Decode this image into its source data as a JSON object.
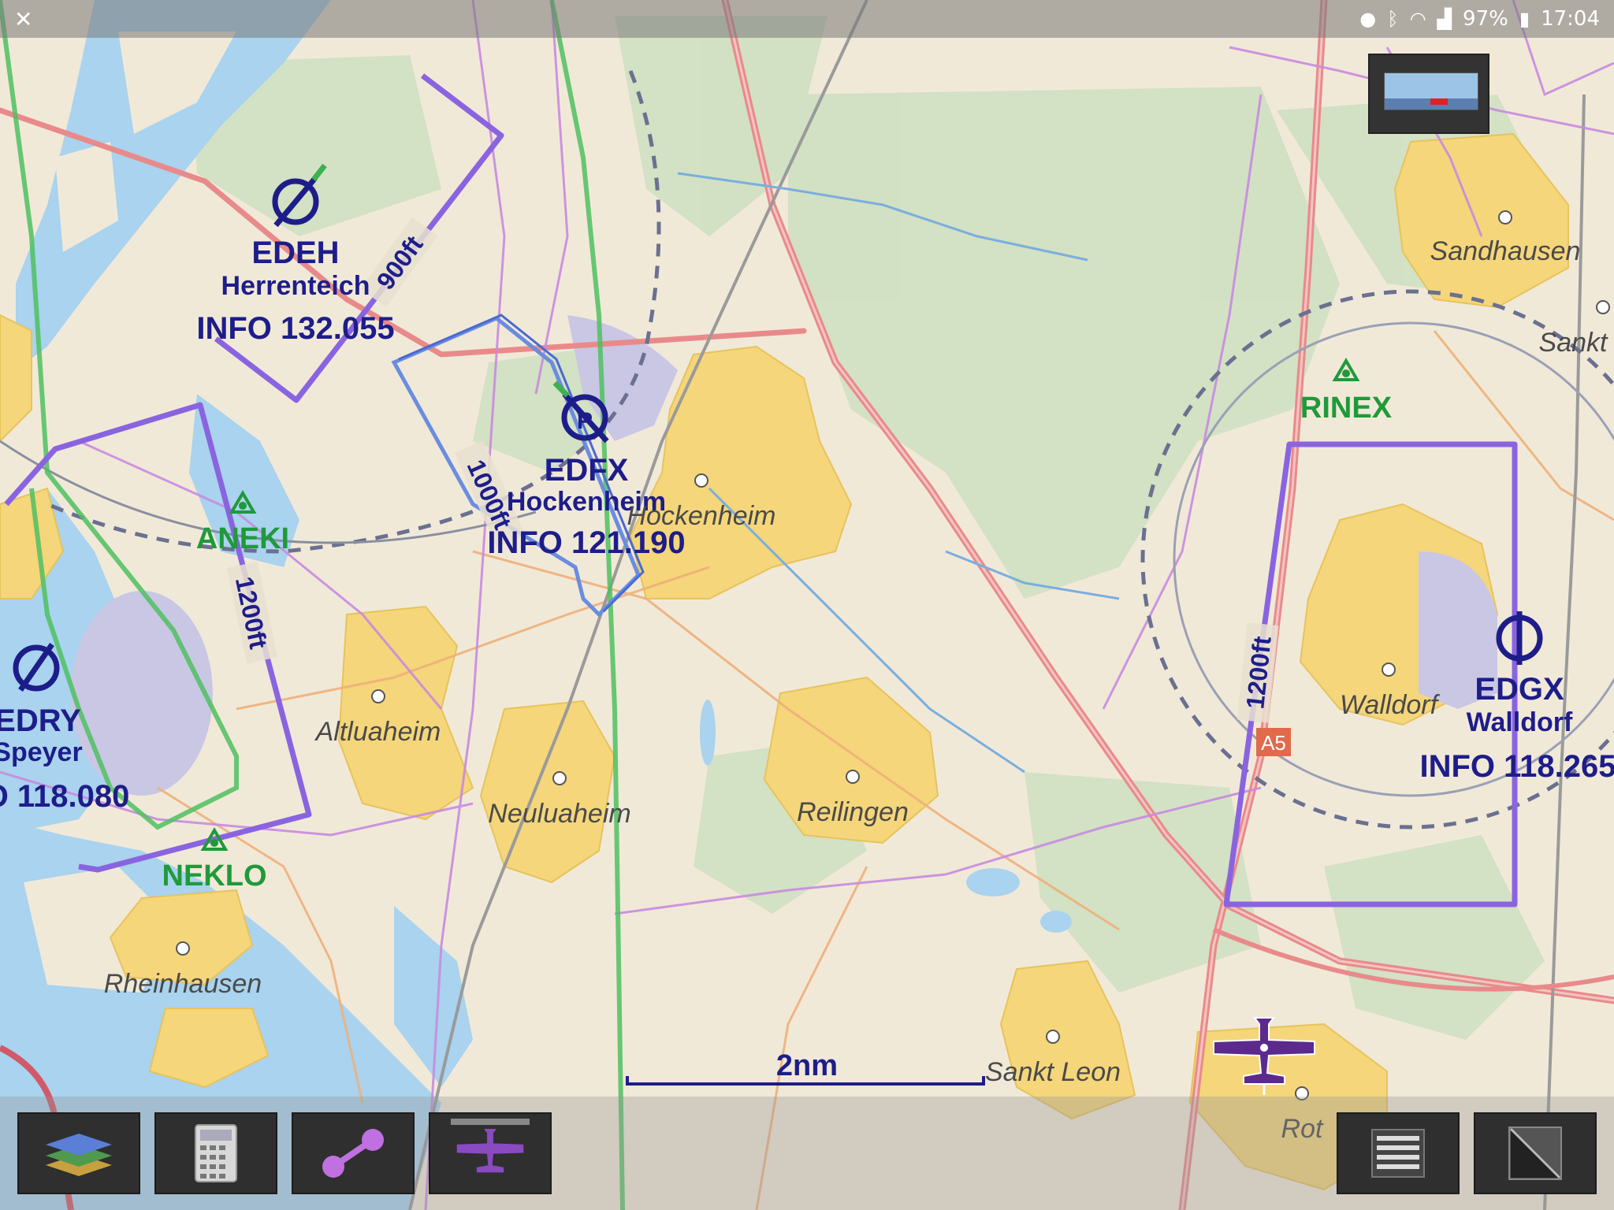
{
  "status_bar": {
    "app_icon": "x-icon",
    "battery_percent": "97%",
    "time": "17:04",
    "icons": [
      "location-icon",
      "bluetooth-icon",
      "wifi-icon",
      "signal-icon",
      "battery-icon"
    ]
  },
  "airports": [
    {
      "icao": "EDEH",
      "name": "Herrenteich",
      "freq": "INFO 132.055"
    },
    {
      "icao": "EDFX",
      "name": "Hockenheim",
      "freq": "INFO 121.190"
    },
    {
      "icao": "EDGX",
      "name": "Walldorf",
      "freq": "INFO 118.265"
    },
    {
      "icao": "EDRY",
      "name": "Speyer",
      "freq": "O 118.080"
    }
  ],
  "waypoints": [
    "ANEKI",
    "NEKLO",
    "RINEX"
  ],
  "towns": [
    "Sandhausen",
    "Sankt",
    "Hockenheim",
    "Altluaheim",
    "Neuluaheim",
    "Reilingen",
    "Walldorf",
    "Rheinhausen",
    "Sankt Leon",
    "Rot"
  ],
  "altitude_labels": [
    "900ft",
    "1000ft",
    "1200ft",
    "1200ft"
  ],
  "road_label": "A5",
  "scale": {
    "label": "2nm"
  },
  "colors": {
    "land": "#f1e9d8",
    "forest": "#cfe0c2",
    "water": "#a9d3ee",
    "town": "#f5d67a",
    "airspace_purple": "#8a64e0",
    "label_blue": "#1d1d8a",
    "waypoint_green": "#1f9a3a",
    "road_red": "#e98a8a"
  },
  "toolbar": {
    "buttons": [
      "layers-icon",
      "calculator-icon",
      "route-icon",
      "aircraft-icon",
      "menu-icon",
      "fullscreen-icon"
    ]
  }
}
